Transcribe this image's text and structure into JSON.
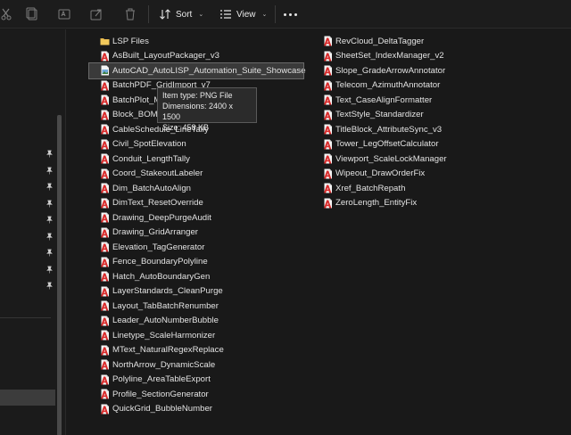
{
  "toolbar": {
    "sort_label": "Sort",
    "view_label": "View"
  },
  "tooltip": {
    "item_type": "Item type: PNG File",
    "dimensions": "Dimensions: 2400 x 1500",
    "size": "Size: 458 KB"
  },
  "files_col1": [
    {
      "name": "LSP Files",
      "icon": "folder-icon"
    },
    {
      "name": "AsBuilt_LayoutPackager_v3",
      "icon": "autocad-lsp-icon"
    },
    {
      "name": "AutoCAD_AutoLISP_Automation_Suite_Showcase",
      "icon": "png-image-icon",
      "selected": true
    },
    {
      "name": "BatchPDF_GridImport_v7",
      "icon": "autocad-lsp-icon"
    },
    {
      "name": "BatchPlot_M",
      "icon": "autocad-lsp-icon"
    },
    {
      "name": "Block_BOM_",
      "icon": "autocad-lsp-icon"
    },
    {
      "name": "CableSchedule_LineTally",
      "icon": "autocad-lsp-icon"
    },
    {
      "name": "Civil_SpotElevation",
      "icon": "autocad-lsp-icon"
    },
    {
      "name": "Conduit_LengthTally",
      "icon": "autocad-lsp-icon"
    },
    {
      "name": "Coord_StakeoutLabeler",
      "icon": "autocad-lsp-icon"
    },
    {
      "name": "Dim_BatchAutoAlign",
      "icon": "autocad-lsp-icon"
    },
    {
      "name": "DimText_ResetOverride",
      "icon": "autocad-lsp-icon"
    },
    {
      "name": "Drawing_DeepPurgeAudit",
      "icon": "autocad-lsp-icon"
    },
    {
      "name": "Drawing_GridArranger",
      "icon": "autocad-lsp-icon"
    },
    {
      "name": "Elevation_TagGenerator",
      "icon": "autocad-lsp-icon"
    },
    {
      "name": "Fence_BoundaryPolyline",
      "icon": "autocad-lsp-icon"
    },
    {
      "name": "Hatch_AutoBoundaryGen",
      "icon": "autocad-lsp-icon"
    },
    {
      "name": "LayerStandards_CleanPurge",
      "icon": "autocad-lsp-icon"
    },
    {
      "name": "Layout_TabBatchRenumber",
      "icon": "autocad-lsp-icon"
    },
    {
      "name": "Leader_AutoNumberBubble",
      "icon": "autocad-lsp-icon"
    },
    {
      "name": "Linetype_ScaleHarmonizer",
      "icon": "autocad-lsp-icon"
    },
    {
      "name": "MText_NaturalRegexReplace",
      "icon": "autocad-lsp-icon"
    },
    {
      "name": "NorthArrow_DynamicScale",
      "icon": "autocad-lsp-icon"
    },
    {
      "name": "Polyline_AreaTableExport",
      "icon": "autocad-lsp-icon"
    },
    {
      "name": "Profile_SectionGenerator",
      "icon": "autocad-lsp-icon"
    },
    {
      "name": "QuickGrid_BubbleNumber",
      "icon": "autocad-lsp-icon"
    }
  ],
  "files_col2": [
    {
      "name": "RevCloud_DeltaTagger",
      "icon": "autocad-lsp-icon"
    },
    {
      "name": "SheetSet_IndexManager_v2",
      "icon": "autocad-lsp-icon"
    },
    {
      "name": "Slope_GradeArrowAnnotator",
      "icon": "autocad-lsp-icon"
    },
    {
      "name": "Telecom_AzimuthAnnotator",
      "icon": "autocad-lsp-icon"
    },
    {
      "name": "Text_CaseAlignFormatter",
      "icon": "autocad-lsp-icon"
    },
    {
      "name": "TextStyle_Standardizer",
      "icon": "autocad-lsp-icon"
    },
    {
      "name": "TitleBlock_AttributeSync_v3",
      "icon": "autocad-lsp-icon"
    },
    {
      "name": "Tower_LegOffsetCalculator",
      "icon": "autocad-lsp-icon"
    },
    {
      "name": "Viewport_ScaleLockManager",
      "icon": "autocad-lsp-icon"
    },
    {
      "name": "Wipeout_DrawOrderFix",
      "icon": "autocad-lsp-icon"
    },
    {
      "name": "Xref_BatchRepath",
      "icon": "autocad-lsp-icon"
    },
    {
      "name": "ZeroLength_EntityFix",
      "icon": "autocad-lsp-icon"
    }
  ],
  "colors": {
    "background": "#191919",
    "selection": "#3a3a3a",
    "lsp_red": "#d92b2b",
    "folder_yellow": "#e8b84a"
  }
}
